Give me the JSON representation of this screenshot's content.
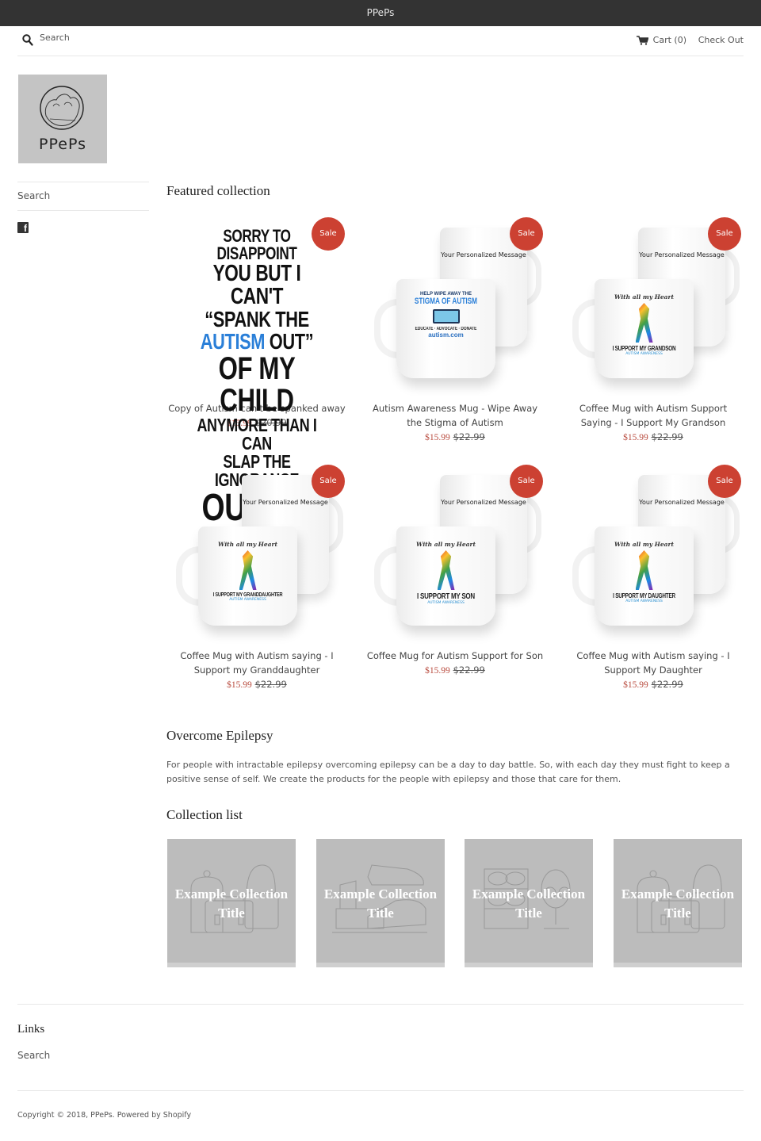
{
  "announcement": {
    "text": "PPePs"
  },
  "header": {
    "search_placeholder": "Search",
    "cart_label": "Cart (0)",
    "checkout_label": "Check Out"
  },
  "logo": {
    "text": "PPePs"
  },
  "sidebar": {
    "items": [
      {
        "label": "Search"
      }
    ],
    "social": [
      {
        "icon": "facebook-icon"
      }
    ]
  },
  "featured": {
    "title": "Featured collection",
    "products": [
      {
        "title": "Copy of Autism can't be spanked away",
        "badge": "Sale",
        "sale_price": "$15.99",
        "original_price": "$20.99",
        "image": {
          "type": "poster",
          "lines": [
            "SORRY TO DISAPPOINT",
            "YOU BUT I CAN'T",
            "“SPANK THE",
            "AUTISM",
            "OUT”",
            "OF MY CHILD",
            "ANYMORE THAN I CAN",
            "SLAP THE IGNORANCE",
            "OUT OF YOU"
          ]
        }
      },
      {
        "title": "Autism Awareness Mug - Wipe Away the Stigma of Autism",
        "badge": "Sale",
        "sale_price": "$15.99",
        "original_price": "$22.99",
        "image": {
          "type": "mug",
          "back_message": "Your Personalized Message",
          "front_top": "HELP WIPE AWAY THE",
          "front_main": "STIGMA OF AUTISM",
          "front_bottom": "EDUCATE · ADVOCATE · DONATE",
          "front_url": "autism.com"
        }
      },
      {
        "title": "Coffee Mug with Autism Support Saying - I Support My Grandson",
        "badge": "Sale",
        "sale_price": "$15.99",
        "original_price": "$22.99",
        "image": {
          "type": "mug",
          "back_message": "Your Personalized Message",
          "front_script": "With all my Heart",
          "front_main": "I SUPPORT MY GRANDSON",
          "front_sub": "AUTISM AWARENESS"
        }
      },
      {
        "title": "Coffee Mug with Autism saying - I Support my Granddaughter",
        "badge": "Sale",
        "sale_price": "$15.99",
        "original_price": "$22.99",
        "image": {
          "type": "mug",
          "back_message": "Your Personalized Message",
          "front_script": "With all my Heart",
          "front_main": "I SUPPORT MY GRANDDAUGHTER",
          "front_sub": "AUTISM AWARENESS"
        }
      },
      {
        "title": "Coffee Mug for Autism Support for Son",
        "badge": "Sale",
        "sale_price": "$15.99",
        "original_price": "$22.99",
        "image": {
          "type": "mug",
          "back_message": "Your Personalized Message",
          "front_script": "With all my Heart",
          "front_main": "I SUPPORT MY SON",
          "front_sub": "AUTISM AWARENESS"
        }
      },
      {
        "title": "Coffee Mug with Autism saying - I Support My Daughter",
        "badge": "Sale",
        "sale_price": "$15.99",
        "original_price": "$22.99",
        "image": {
          "type": "mug",
          "back_message": "Your Personalized Message",
          "front_script": "With all my Heart",
          "front_main": "I SUPPORT MY DAUGHTER",
          "front_sub": "AUTISM AWARENESS"
        }
      }
    ]
  },
  "about": {
    "title": "Overcome Epilepsy",
    "text": "For people with intractable epilepsy overcoming epilepsy can be a day to day battle. So, with each day they must fight to keep a positive sense of self. We create the products for the people with epilepsy and those that care for them."
  },
  "collection_list": {
    "title": "Collection list",
    "items": [
      {
        "title": "Example Collection Title",
        "illustration": "bags"
      },
      {
        "title": "Example Collection Title",
        "illustration": "shoes"
      },
      {
        "title": "Example Collection Title",
        "illustration": "eyewear"
      },
      {
        "title": "Example Collection Title",
        "illustration": "bags"
      }
    ]
  },
  "footer": {
    "links_title": "Links",
    "links": [
      {
        "label": "Search"
      }
    ],
    "copyright": "Copyright © 2018, PPePs. Powered by Shopify"
  },
  "colors": {
    "announcement_bg": "#333333",
    "sale_badge": "#cc4132",
    "sale_price": "#b84a3d",
    "placeholder_bg": "#bcbcbc"
  }
}
